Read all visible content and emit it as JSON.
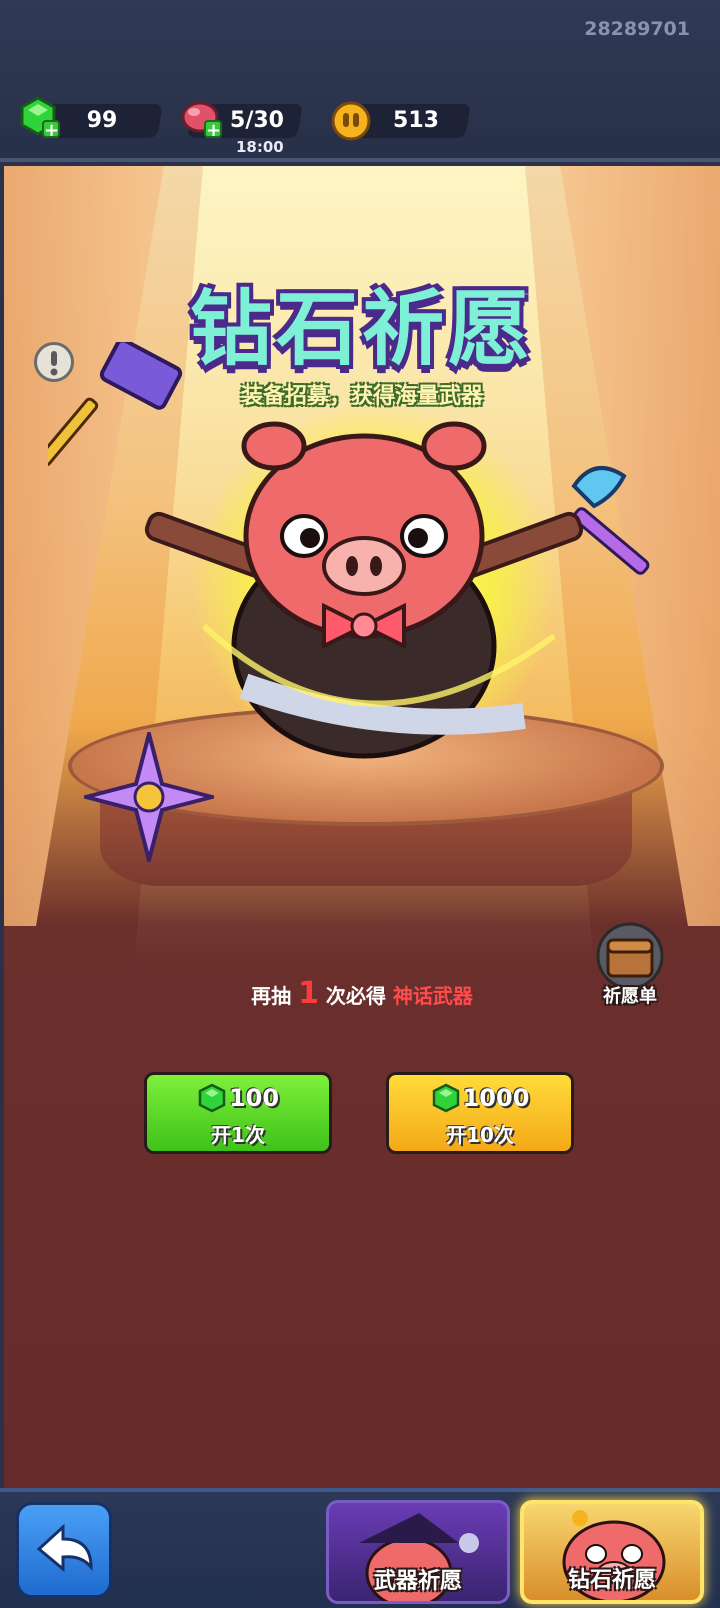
{
  "header": {
    "uid": "28289701",
    "resources": [
      {
        "icon": "green-gem-icon",
        "value": "99"
      },
      {
        "icon": "meat-stamina-icon",
        "value": "5/30",
        "timer": "18:00"
      },
      {
        "icon": "gold-coin-icon",
        "value": "513"
      }
    ]
  },
  "banner": {
    "title": "钻石祈愿",
    "subtitle": "装备招募，获得海量武器"
  },
  "pity": {
    "prefix": "再抽",
    "count": "1",
    "middle": "次必得",
    "reward": "神话武器"
  },
  "wishlist": {
    "label": "祈愿单",
    "icon": "treasure-chest-icon"
  },
  "draw_buttons": [
    {
      "cost": "100",
      "label": "开1次",
      "color": "#4ccf22"
    },
    {
      "cost": "1000",
      "label": "开10次",
      "color": "#f7b822"
    }
  ],
  "bottom_nav": {
    "back_icon": "back-arrow-icon",
    "tabs": [
      {
        "label": "武器祈愿",
        "active": false
      },
      {
        "label": "钻石祈愿",
        "active": true
      }
    ]
  },
  "colors": {
    "gem": "#2fd33a",
    "accent_red": "#ff3b3b",
    "title": "#7ef0d6"
  }
}
